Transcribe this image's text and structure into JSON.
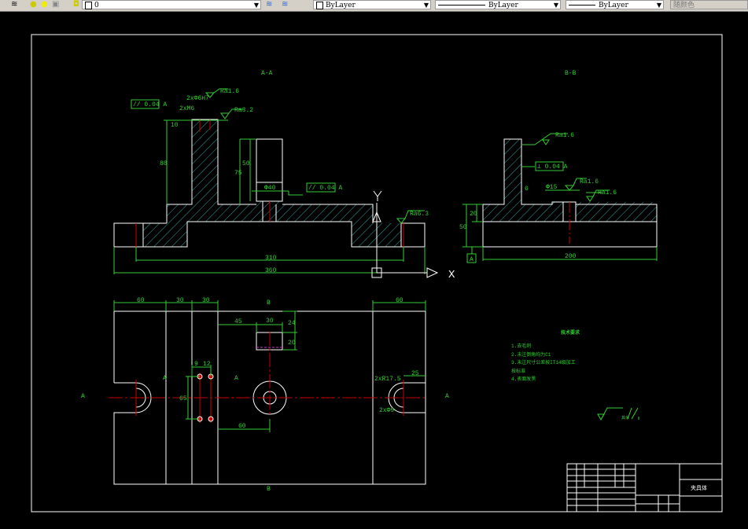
{
  "toolbar": {
    "layer_value": "0",
    "color_value": "ByLayer",
    "linetype_value": "ByLayer",
    "lineweight_value": "ByLayer",
    "plotstyle_value": "随颜色",
    "icons": [
      "layers-icon",
      "bulb-icon",
      "sun-icon",
      "lock-icon",
      "color-square-icon",
      "layer-prev-icon",
      "layer-manager-icon"
    ]
  },
  "drawing": {
    "section_aa": "A-A",
    "section_bb": "B-B",
    "ucs_x": "X",
    "ucs_y": "Y",
    "aa": {
      "tol1": "// 0.04 A",
      "tol2": "// 0.04 A",
      "ra16": "Ra1.6",
      "ra32": "Ra3.2",
      "ra63": "Ra6.3",
      "holes1": "2xM6",
      "holes2": "2xФ6H7",
      "d88": "88",
      "d50": "50",
      "d75": "75",
      "d40": "Ф40",
      "d10": "10",
      "d310": "310",
      "d360": "360"
    },
    "bb": {
      "ra16a": "Ra1.6",
      "ra16b": "Ra1.6",
      "ra16c": "Ra1.6",
      "tol": "⊥ 0.04 A",
      "d6": "6",
      "d15": "Ф15",
      "d20": "20",
      "d50": "50",
      "d200": "200",
      "datum": "A"
    },
    "plan": {
      "d60a": "60",
      "d30a": "30",
      "d30b": "30",
      "d60b": "60",
      "d45": "45",
      "d30c": "30",
      "d24": "24",
      "d20": "20",
      "d9": "9",
      "d12": "12",
      "d25": "25",
      "d65": "65",
      "d60c": "60",
      "r175": "2xR17.5",
      "d9b": "2xФ9",
      "sec_a": "A",
      "sec_b": "B"
    },
    "notes": {
      "title": "技术要求",
      "items": [
        "1.去毛刺",
        "2.未注倒角均为C1",
        "3.未注尺寸公差按IT14级加工",
        "    按标准",
        "4.表面发黑"
      ]
    },
    "roughness_note": "其余",
    "title_block": {
      "name": "夹具体"
    }
  }
}
